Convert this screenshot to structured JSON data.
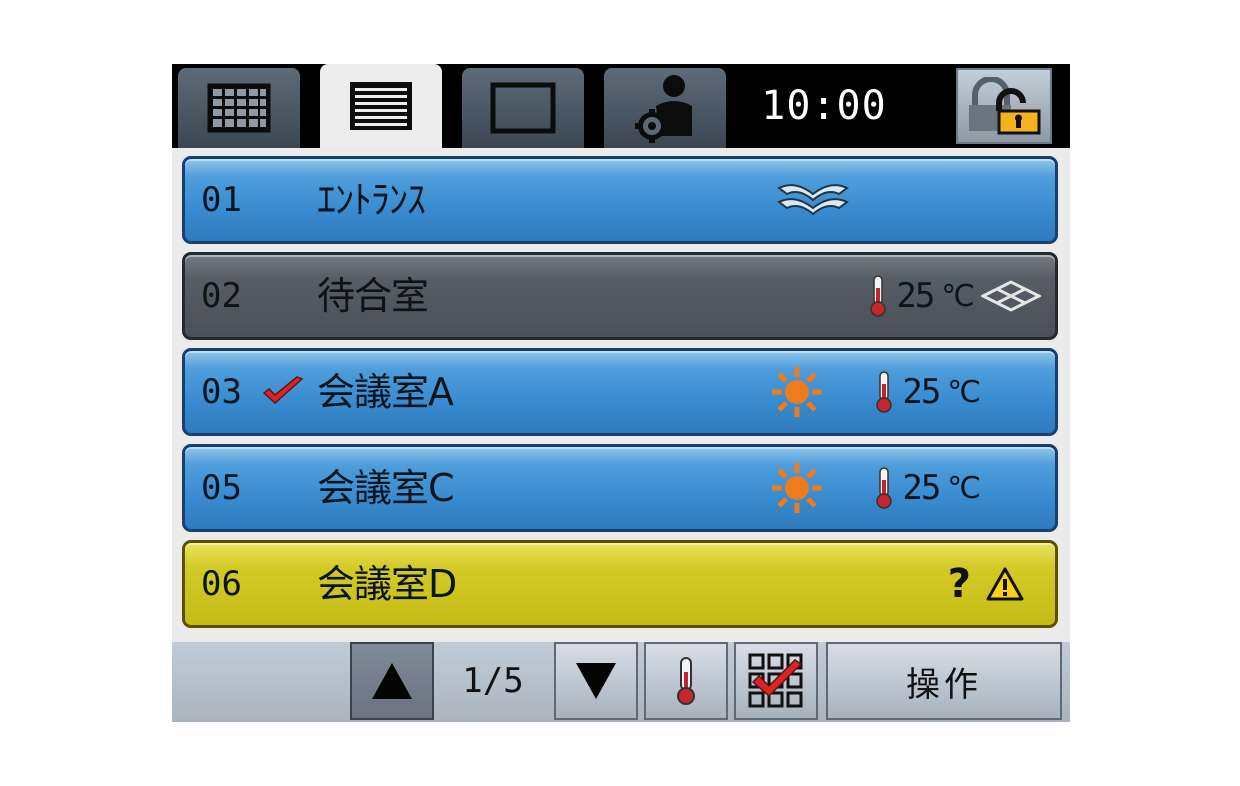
{
  "header": {
    "clock": "10:00",
    "tabs": [
      {
        "name": "grid-view",
        "active": false
      },
      {
        "name": "list-view",
        "active": true
      },
      {
        "name": "single-view",
        "active": false
      },
      {
        "name": "user-settings",
        "active": false
      }
    ]
  },
  "rows": [
    {
      "number": "01",
      "name": "ｴﾝﾄﾗﾝｽ",
      "state": "on",
      "checked": false,
      "icons": [
        "fan-icon"
      ],
      "temperature": ""
    },
    {
      "number": "02",
      "name": "待合室",
      "state": "off",
      "checked": false,
      "icons": [
        "thermometer-icon",
        "fan-outline-icon"
      ],
      "temperature": "25",
      "unit": "℃"
    },
    {
      "number": "03",
      "name": "会議室A",
      "state": "on",
      "checked": true,
      "icons": [
        "sun-icon",
        "thermometer-icon"
      ],
      "temperature": "25",
      "unit": "℃"
    },
    {
      "number": "05",
      "name": "会議室C",
      "state": "on",
      "checked": false,
      "icons": [
        "sun-icon",
        "thermometer-icon"
      ],
      "temperature": "25",
      "unit": "℃"
    },
    {
      "number": "06",
      "name": "会議室D",
      "state": "warning",
      "checked": false,
      "icons": [
        "question-icon",
        "warning-icon"
      ],
      "status_text": "?"
    }
  ],
  "footer": {
    "page_indicator": "1/5",
    "operate_label": "操作",
    "buttons": [
      "page-up",
      "page-down",
      "temperature",
      "select-all"
    ]
  },
  "colors": {
    "row_on": "#3a8cd0",
    "row_off": "#565d65",
    "row_warning": "#d3ca27",
    "check": "#d7262b",
    "sun": "#ee7b1c",
    "thermo": "#c4262b"
  }
}
